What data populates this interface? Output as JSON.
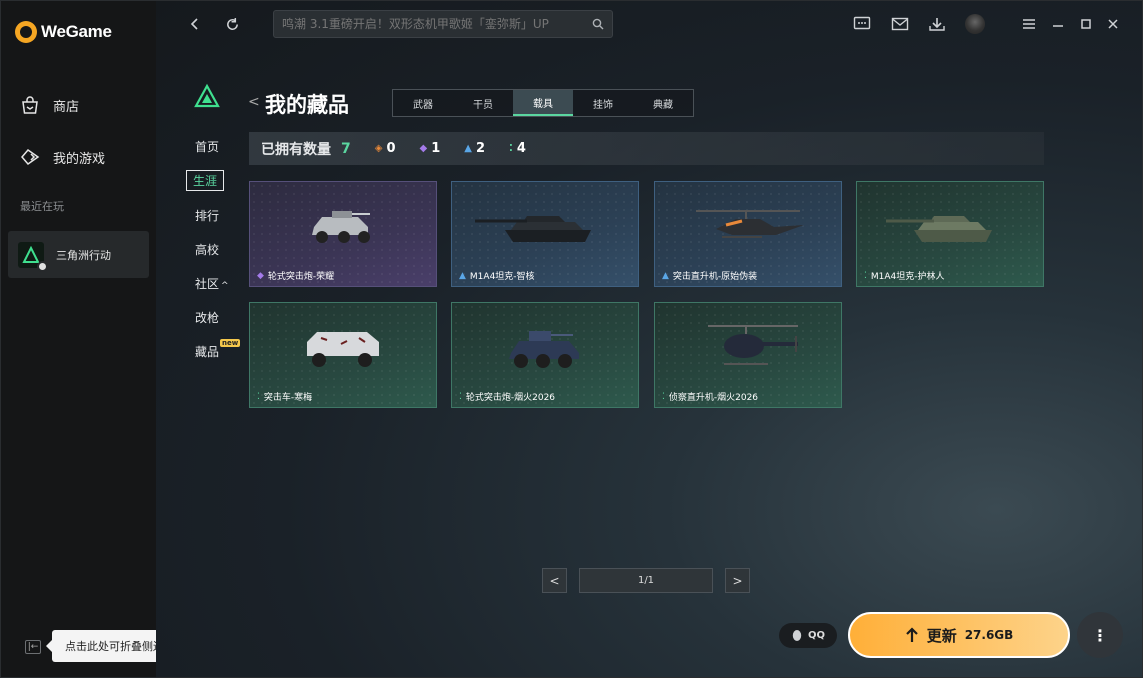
{
  "app": {
    "name": "WeGame"
  },
  "sidebar": {
    "items": [
      {
        "label": "商店",
        "icon": "shopping-bag-icon"
      },
      {
        "label": "我的游戏",
        "icon": "gamepad-icon"
      }
    ],
    "recent_label": "最近在玩",
    "recent_game": "三角洲行动",
    "collapse_tooltip": "点击此处可折叠侧边栏"
  },
  "topbar": {
    "search_placeholder": "鸣潮 3.1重磅开启！双形态机甲歌姬「銮弥斯」UP"
  },
  "content": {
    "title": "我的藏品",
    "tabs": [
      {
        "label": "武器",
        "active": false
      },
      {
        "label": "干员",
        "active": false
      },
      {
        "label": "载具",
        "active": true
      },
      {
        "label": "挂饰",
        "active": false
      },
      {
        "label": "典藏",
        "active": false
      }
    ],
    "left_menu": [
      {
        "label": "首页",
        "active": false
      },
      {
        "label": "生涯",
        "active": true
      },
      {
        "label": "排行",
        "active": false
      },
      {
        "label": "高校",
        "active": false
      },
      {
        "label": "社区",
        "active": false,
        "suffix": "^"
      },
      {
        "label": "改枪",
        "active": false
      },
      {
        "label": "藏品",
        "active": false,
        "tag": "new"
      }
    ],
    "stats": {
      "label": "已拥有数量",
      "total": "7",
      "counts": [
        {
          "rarity": "orange",
          "value": "0"
        },
        {
          "rarity": "purple",
          "value": "1"
        },
        {
          "rarity": "blue",
          "value": "2"
        },
        {
          "rarity": "green",
          "value": "4"
        }
      ]
    },
    "items": [
      {
        "name": "轮式突击炮-荣耀",
        "rarity": "purple",
        "kind": "armored-car"
      },
      {
        "name": "M1A4坦克-智核",
        "rarity": "blue",
        "kind": "tank"
      },
      {
        "name": "突击直升机-原始伪装",
        "rarity": "blue",
        "kind": "attack-helicopter"
      },
      {
        "name": "M1A4坦克-护林人",
        "rarity": "green",
        "kind": "tank"
      },
      {
        "name": "突击车-寒梅",
        "rarity": "green",
        "kind": "apc"
      },
      {
        "name": "轮式突击炮-烟火2026",
        "rarity": "green",
        "kind": "armored-car"
      },
      {
        "name": "侦察直升机-烟火2026",
        "rarity": "green",
        "kind": "scout-helicopter"
      }
    ],
    "pagination": "1/1"
  },
  "actions": {
    "qq_label": "QQ",
    "update_label": "更新",
    "update_size": "27.6GB"
  }
}
